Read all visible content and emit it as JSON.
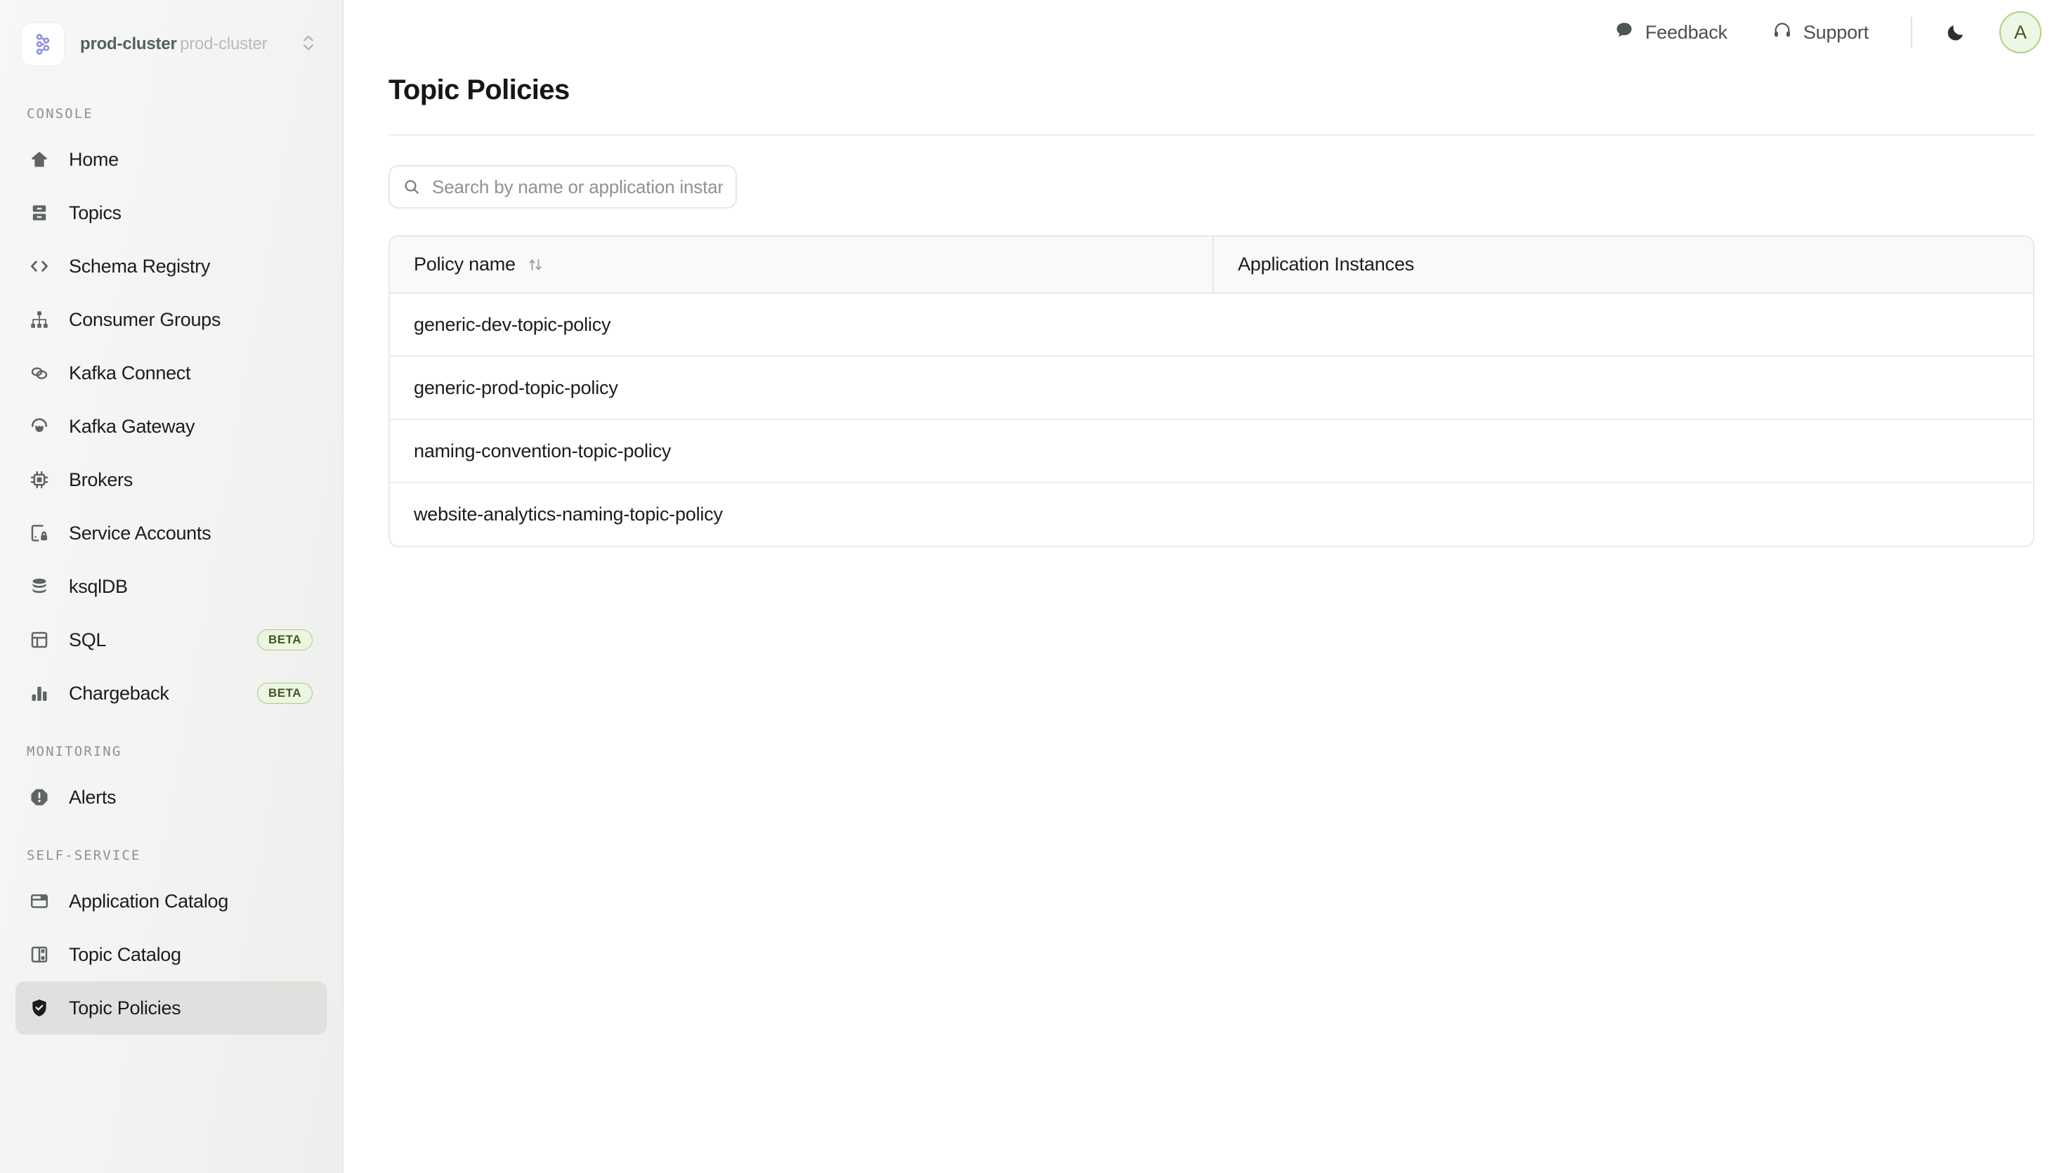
{
  "sidebar": {
    "cluster": {
      "name": "prod-cluster",
      "subtitle": "prod-cluster",
      "logo_icon": "kafka-logo-icon",
      "selector_icon": "chevron-up-down-icon"
    },
    "sections": [
      {
        "label": "CONSOLE",
        "items": [
          {
            "label": "Home",
            "icon": "home-icon",
            "active": false,
            "badge": ""
          },
          {
            "label": "Topics",
            "icon": "topics-icon",
            "active": false,
            "badge": ""
          },
          {
            "label": "Schema Registry",
            "icon": "code-brackets-icon",
            "active": false,
            "badge": ""
          },
          {
            "label": "Consumer Groups",
            "icon": "hierarchy-icon",
            "active": false,
            "badge": ""
          },
          {
            "label": "Kafka Connect",
            "icon": "link-chain-icon",
            "active": false,
            "badge": ""
          },
          {
            "label": "Kafka Gateway",
            "icon": "gateway-plug-icon",
            "active": false,
            "badge": ""
          },
          {
            "label": "Brokers",
            "icon": "cpu-chip-icon",
            "active": false,
            "badge": ""
          },
          {
            "label": "Service Accounts",
            "icon": "card-lock-icon",
            "active": false,
            "badge": ""
          },
          {
            "label": "ksqlDB",
            "icon": "database-icon",
            "active": false,
            "badge": ""
          },
          {
            "label": "SQL",
            "icon": "table-grid-icon",
            "active": false,
            "badge": "BETA"
          },
          {
            "label": "Chargeback",
            "icon": "bar-chart-icon",
            "active": false,
            "badge": "BETA"
          }
        ]
      },
      {
        "label": "MONITORING",
        "items": [
          {
            "label": "Alerts",
            "icon": "alert-octagon-icon",
            "active": false,
            "badge": ""
          }
        ]
      },
      {
        "label": "SELF-SERVICE",
        "items": [
          {
            "label": "Application Catalog",
            "icon": "window-catalog-icon",
            "active": false,
            "badge": ""
          },
          {
            "label": "Topic Catalog",
            "icon": "layout-panels-icon",
            "active": false,
            "badge": ""
          },
          {
            "label": "Topic Policies",
            "icon": "shield-check-icon",
            "active": true,
            "badge": ""
          }
        ]
      }
    ]
  },
  "topbar": {
    "feedback_label": "Feedback",
    "feedback_icon": "chat-bubble-icon",
    "support_label": "Support",
    "support_icon": "headphones-icon",
    "theme_toggle_icon": "moon-icon",
    "avatar_initial": "A"
  },
  "page": {
    "title": "Topic Policies"
  },
  "search": {
    "placeholder": "Search by name or application instance",
    "value": "",
    "icon": "search-icon"
  },
  "table": {
    "columns": [
      {
        "label": "Policy name",
        "sortable": true,
        "sort_icon": "sort-arrows-icon"
      },
      {
        "label": "Application Instances",
        "sortable": false,
        "sort_icon": ""
      }
    ],
    "rows": [
      {
        "policy_name": "generic-dev-topic-policy",
        "application_instances": ""
      },
      {
        "policy_name": "generic-prod-topic-policy",
        "application_instances": ""
      },
      {
        "policy_name": "naming-convention-topic-policy",
        "application_instances": ""
      },
      {
        "policy_name": "website-analytics-naming-topic-policy",
        "application_instances": ""
      }
    ]
  },
  "colors": {
    "accent_green": "#aed47f",
    "beta_badge_bg": "#ecf4e2",
    "beta_badge_text": "#3f5722",
    "active_nav_bg": "#e0e1de",
    "sidebar_bg": "#f3f3f2"
  }
}
